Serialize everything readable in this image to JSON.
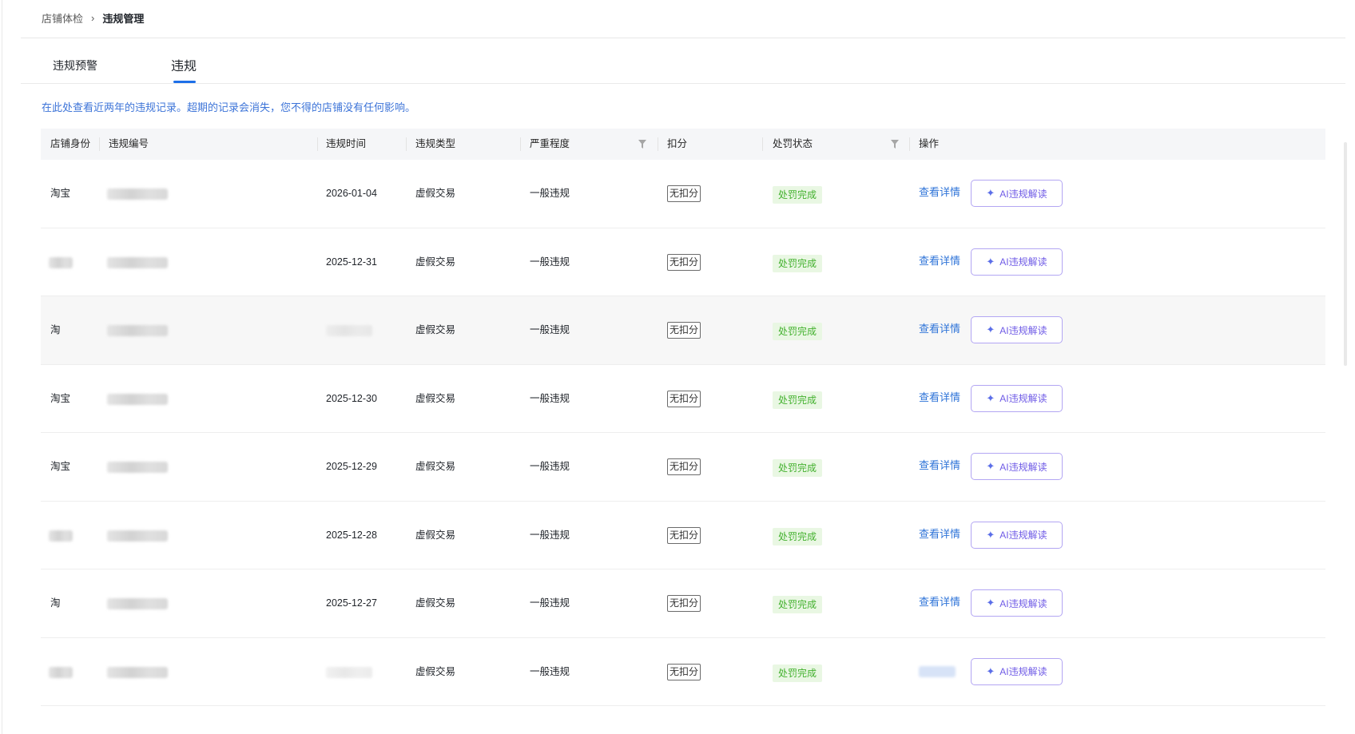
{
  "breadcrumb": {
    "parent": "店铺体检",
    "separator": "›",
    "current": "违规管理"
  },
  "tabs": [
    {
      "label": "违规预警"
    },
    {
      "label": "违规"
    }
  ],
  "notice": "在此处查看近两年的违规记录。超期的记录会消失，您不得的店铺没有任何影响。",
  "table": {
    "columns": [
      "店铺身份",
      "违规编号",
      "违规时间",
      "违规类型",
      "严重程度",
      "扣分",
      "处罚状态",
      "操作"
    ],
    "rows": [
      {
        "shop": "淘宝",
        "time": "2026-01-04",
        "type": "虚假交易",
        "severity": "一般违规",
        "points": "无扣分",
        "status": "处罚完成",
        "detail": "查看详情",
        "ai": "AI违规解读"
      },
      {
        "shop": "",
        "time": "2025-12-31",
        "type": "虚假交易",
        "severity": "一般违规",
        "points": "无扣分",
        "status": "处罚完成",
        "detail": "查看详情",
        "ai": "AI违规解读"
      },
      {
        "shop": "淘",
        "time": "",
        "type": "虚假交易",
        "severity": "一般违规",
        "points": "无扣分",
        "status": "处罚完成",
        "detail": "查看详情",
        "ai": "AI违规解读"
      },
      {
        "shop": "淘宝",
        "time": "2025-12-30",
        "type": "虚假交易",
        "severity": "一般违规",
        "points": "无扣分",
        "status": "处罚完成",
        "detail": "查看详情",
        "ai": "AI违规解读"
      },
      {
        "shop": "淘宝",
        "time": "2025-12-29",
        "type": "虚假交易",
        "severity": "一般违规",
        "points": "无扣分",
        "status": "处罚完成",
        "detail": "查看详情",
        "ai": "AI违规解读"
      },
      {
        "shop": "",
        "time": "2025-12-28",
        "type": "虚假交易",
        "severity": "一般违规",
        "points": "无扣分",
        "status": "处罚完成",
        "detail": "查看详情",
        "ai": "AI违规解读"
      },
      {
        "shop": "淘",
        "time": "2025-12-27",
        "type": "虚假交易",
        "severity": "一般违规",
        "points": "无扣分",
        "status": "处罚完成",
        "detail": "查看详情",
        "ai": "AI违规解读"
      },
      {
        "shop": "",
        "time": "",
        "type": "虚假交易",
        "severity": "一般违规",
        "points": "无扣分",
        "status": "处罚完成",
        "detail": "",
        "ai": "AI违规解读"
      }
    ]
  },
  "icons": {
    "filter": "filter-icon",
    "ai_spark": "sparkle-icon"
  },
  "colors": {
    "accent": "#1d6fe8",
    "link": "#2f74d8",
    "success_text": "#43b12e",
    "success_bg": "#e9f7e3",
    "ai_border": "#b3a6f3"
  }
}
